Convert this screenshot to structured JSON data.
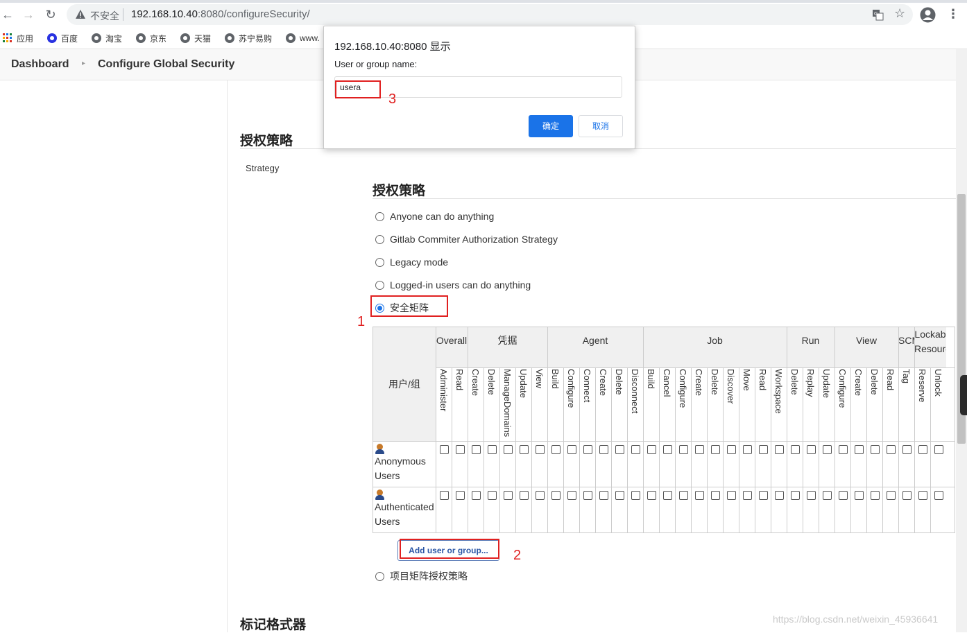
{
  "browser": {
    "insecure_label": "不安全",
    "url_host": "192.168.10.40",
    "url_rest": ":8080/configureSecurity/",
    "bookmarks": [
      "应用",
      "百度",
      "淘宝",
      "京东",
      "天猫",
      "苏宁易购",
      "www."
    ]
  },
  "breadcrumb": {
    "dashboard": "Dashboard",
    "page": "Configure Global Security"
  },
  "dialog": {
    "title": "192.168.10.40:8080 显示",
    "prompt": "User or group name:",
    "input_value": "usera",
    "ok_label": "确定",
    "cancel_label": "取消"
  },
  "auth": {
    "section_title": "授权策略",
    "strategy_label": "Strategy",
    "inner_title": "授权策略",
    "options": [
      "Anyone can do anything",
      "Gitlab Commiter Authorization Strategy",
      "Legacy mode",
      "Logged-in users can do anything",
      "安全矩阵"
    ],
    "selected_option": "安全矩阵",
    "last_option": "项目矩阵授权策略"
  },
  "matrix": {
    "user_group_header": "用户/组",
    "groups": [
      {
        "name": "Overall",
        "perms": [
          "Administer",
          "Read"
        ]
      },
      {
        "name": "凭据",
        "perms": [
          "Create",
          "Delete",
          "ManageDomains",
          "Update",
          "View"
        ]
      },
      {
        "name": "Agent",
        "perms": [
          "Build",
          "Configure",
          "Connect",
          "Create",
          "Delete",
          "Disconnect"
        ]
      },
      {
        "name": "Job",
        "perms": [
          "Build",
          "Cancel",
          "Configure",
          "Create",
          "Delete",
          "Discover",
          "Move",
          "Read",
          "Workspace"
        ]
      },
      {
        "name": "Run",
        "perms": [
          "Delete",
          "Replay",
          "Update"
        ]
      },
      {
        "name": "View",
        "perms": [
          "Configure",
          "Create",
          "Delete",
          "Read"
        ]
      },
      {
        "name": "SCM",
        "perms": [
          "Tag"
        ]
      },
      {
        "name": "Lockab Resourc",
        "perms": [
          "Reserve",
          "Unlock"
        ]
      }
    ],
    "rows": [
      {
        "name": "Anonymous Users"
      },
      {
        "name": "Authenticated Users"
      }
    ],
    "add_button": "Add user or group..."
  },
  "annotations": {
    "step1": "1",
    "step2": "2",
    "step3": "3"
  },
  "next_section_title": "标记格式器",
  "watermark": "https://blog.csdn.net/weixin_45936641",
  "colors": {
    "accent": "#1a73e8",
    "annotation_red": "#e02020"
  }
}
